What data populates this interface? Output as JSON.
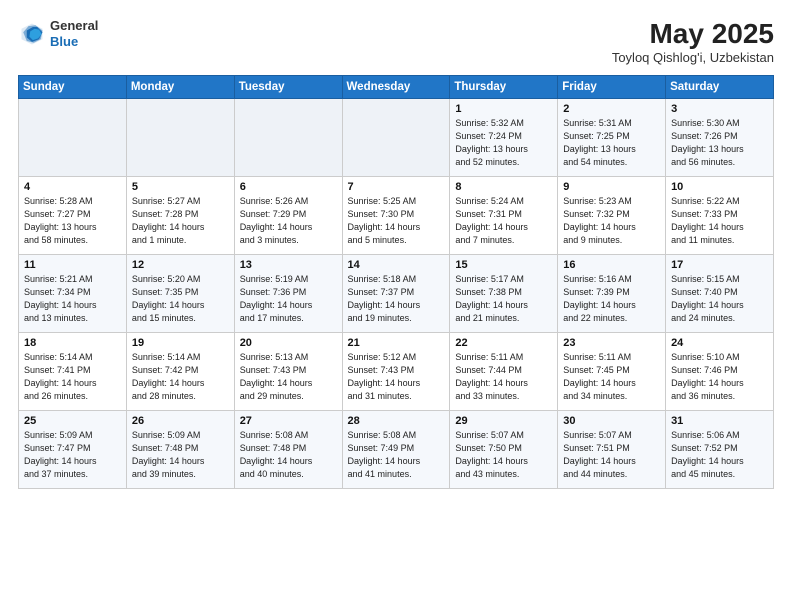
{
  "header": {
    "logo_line1": "General",
    "logo_line2": "Blue",
    "month_year": "May 2025",
    "location": "Toyloq Qishlog'i, Uzbekistan"
  },
  "weekdays": [
    "Sunday",
    "Monday",
    "Tuesday",
    "Wednesday",
    "Thursday",
    "Friday",
    "Saturday"
  ],
  "weeks": [
    [
      {
        "day": "",
        "info": ""
      },
      {
        "day": "",
        "info": ""
      },
      {
        "day": "",
        "info": ""
      },
      {
        "day": "",
        "info": ""
      },
      {
        "day": "1",
        "info": "Sunrise: 5:32 AM\nSunset: 7:24 PM\nDaylight: 13 hours\nand 52 minutes."
      },
      {
        "day": "2",
        "info": "Sunrise: 5:31 AM\nSunset: 7:25 PM\nDaylight: 13 hours\nand 54 minutes."
      },
      {
        "day": "3",
        "info": "Sunrise: 5:30 AM\nSunset: 7:26 PM\nDaylight: 13 hours\nand 56 minutes."
      }
    ],
    [
      {
        "day": "4",
        "info": "Sunrise: 5:28 AM\nSunset: 7:27 PM\nDaylight: 13 hours\nand 58 minutes."
      },
      {
        "day": "5",
        "info": "Sunrise: 5:27 AM\nSunset: 7:28 PM\nDaylight: 14 hours\nand 1 minute."
      },
      {
        "day": "6",
        "info": "Sunrise: 5:26 AM\nSunset: 7:29 PM\nDaylight: 14 hours\nand 3 minutes."
      },
      {
        "day": "7",
        "info": "Sunrise: 5:25 AM\nSunset: 7:30 PM\nDaylight: 14 hours\nand 5 minutes."
      },
      {
        "day": "8",
        "info": "Sunrise: 5:24 AM\nSunset: 7:31 PM\nDaylight: 14 hours\nand 7 minutes."
      },
      {
        "day": "9",
        "info": "Sunrise: 5:23 AM\nSunset: 7:32 PM\nDaylight: 14 hours\nand 9 minutes."
      },
      {
        "day": "10",
        "info": "Sunrise: 5:22 AM\nSunset: 7:33 PM\nDaylight: 14 hours\nand 11 minutes."
      }
    ],
    [
      {
        "day": "11",
        "info": "Sunrise: 5:21 AM\nSunset: 7:34 PM\nDaylight: 14 hours\nand 13 minutes."
      },
      {
        "day": "12",
        "info": "Sunrise: 5:20 AM\nSunset: 7:35 PM\nDaylight: 14 hours\nand 15 minutes."
      },
      {
        "day": "13",
        "info": "Sunrise: 5:19 AM\nSunset: 7:36 PM\nDaylight: 14 hours\nand 17 minutes."
      },
      {
        "day": "14",
        "info": "Sunrise: 5:18 AM\nSunset: 7:37 PM\nDaylight: 14 hours\nand 19 minutes."
      },
      {
        "day": "15",
        "info": "Sunrise: 5:17 AM\nSunset: 7:38 PM\nDaylight: 14 hours\nand 21 minutes."
      },
      {
        "day": "16",
        "info": "Sunrise: 5:16 AM\nSunset: 7:39 PM\nDaylight: 14 hours\nand 22 minutes."
      },
      {
        "day": "17",
        "info": "Sunrise: 5:15 AM\nSunset: 7:40 PM\nDaylight: 14 hours\nand 24 minutes."
      }
    ],
    [
      {
        "day": "18",
        "info": "Sunrise: 5:14 AM\nSunset: 7:41 PM\nDaylight: 14 hours\nand 26 minutes."
      },
      {
        "day": "19",
        "info": "Sunrise: 5:14 AM\nSunset: 7:42 PM\nDaylight: 14 hours\nand 28 minutes."
      },
      {
        "day": "20",
        "info": "Sunrise: 5:13 AM\nSunset: 7:43 PM\nDaylight: 14 hours\nand 29 minutes."
      },
      {
        "day": "21",
        "info": "Sunrise: 5:12 AM\nSunset: 7:43 PM\nDaylight: 14 hours\nand 31 minutes."
      },
      {
        "day": "22",
        "info": "Sunrise: 5:11 AM\nSunset: 7:44 PM\nDaylight: 14 hours\nand 33 minutes."
      },
      {
        "day": "23",
        "info": "Sunrise: 5:11 AM\nSunset: 7:45 PM\nDaylight: 14 hours\nand 34 minutes."
      },
      {
        "day": "24",
        "info": "Sunrise: 5:10 AM\nSunset: 7:46 PM\nDaylight: 14 hours\nand 36 minutes."
      }
    ],
    [
      {
        "day": "25",
        "info": "Sunrise: 5:09 AM\nSunset: 7:47 PM\nDaylight: 14 hours\nand 37 minutes."
      },
      {
        "day": "26",
        "info": "Sunrise: 5:09 AM\nSunset: 7:48 PM\nDaylight: 14 hours\nand 39 minutes."
      },
      {
        "day": "27",
        "info": "Sunrise: 5:08 AM\nSunset: 7:48 PM\nDaylight: 14 hours\nand 40 minutes."
      },
      {
        "day": "28",
        "info": "Sunrise: 5:08 AM\nSunset: 7:49 PM\nDaylight: 14 hours\nand 41 minutes."
      },
      {
        "day": "29",
        "info": "Sunrise: 5:07 AM\nSunset: 7:50 PM\nDaylight: 14 hours\nand 43 minutes."
      },
      {
        "day": "30",
        "info": "Sunrise: 5:07 AM\nSunset: 7:51 PM\nDaylight: 14 hours\nand 44 minutes."
      },
      {
        "day": "31",
        "info": "Sunrise: 5:06 AM\nSunset: 7:52 PM\nDaylight: 14 hours\nand 45 minutes."
      }
    ]
  ]
}
